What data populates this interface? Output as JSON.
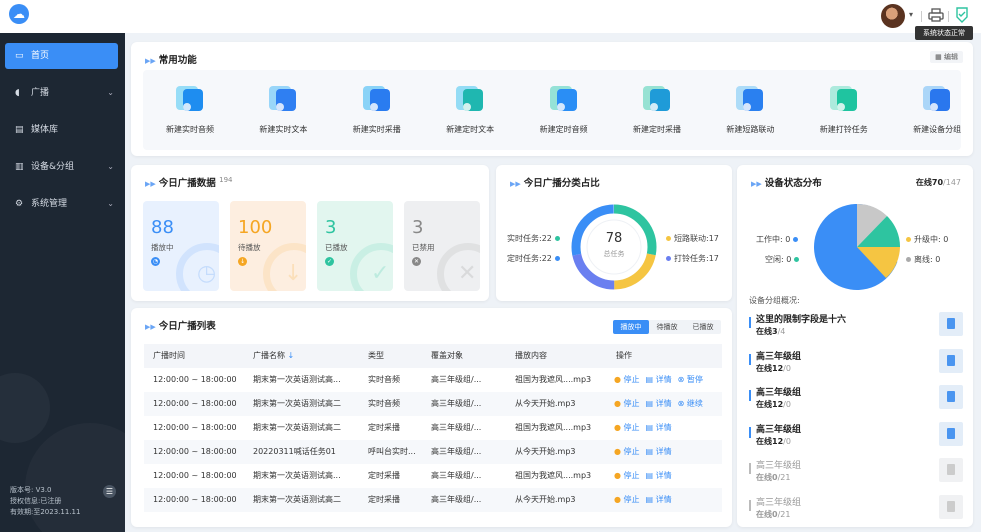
{
  "topbar": {
    "tooltip": "系统状态正常"
  },
  "sidebar": {
    "items": [
      {
        "label": "首页",
        "icon": "monitor-icon"
      },
      {
        "label": "广播",
        "icon": "broadcast-icon"
      },
      {
        "label": "媒体库",
        "icon": "media-library-icon"
      },
      {
        "label": "设备&分组",
        "icon": "device-icon"
      },
      {
        "label": "系统管理",
        "icon": "settings-icon"
      }
    ],
    "version": "版本号: V3.0",
    "license": "授权信息:已注册",
    "expiry": "有效期:至2023.11.11"
  },
  "quick": {
    "title": "常用功能",
    "edit": "编辑",
    "items": [
      {
        "label": "新建实时音频",
        "icon": "music-note-icon"
      },
      {
        "label": "新建实时文本",
        "icon": "text-icon"
      },
      {
        "label": "新建实时采播",
        "icon": "capture-icon"
      },
      {
        "label": "新建定时文本",
        "icon": "timed-text-icon"
      },
      {
        "label": "新建定时音频",
        "icon": "timed-audio-icon"
      },
      {
        "label": "新建定时采播",
        "icon": "timed-capture-icon"
      },
      {
        "label": "新建短路联动",
        "icon": "link-icon"
      },
      {
        "label": "新建打铃任务",
        "icon": "bell-icon"
      },
      {
        "label": "新建设备分组",
        "icon": "device-group-icon"
      }
    ]
  },
  "today_data": {
    "title": "今日广播数据",
    "count": "194",
    "stats": [
      {
        "value": "88",
        "label": "播放中",
        "color": "#3a8ef6",
        "bg": "#e8f1fe"
      },
      {
        "value": "100",
        "label": "待播放",
        "color": "#f5a623",
        "bg": "#fdeee0"
      },
      {
        "value": "3",
        "label": "已播放",
        "color": "#2ec4a0",
        "bg": "#e2f6ef"
      },
      {
        "value": "3",
        "label": "已禁用",
        "color": "#888888",
        "bg": "#eeeff1"
      }
    ]
  },
  "category": {
    "title": "今日广播分类占比",
    "total": "78",
    "total_label": "总任务",
    "legend_left": [
      {
        "label": "实时任务:22",
        "color": "#2ec4a0"
      },
      {
        "label": "定时任务:22",
        "color": "#3a8ef6"
      }
    ],
    "legend_right": [
      {
        "label": "短路联动:17",
        "color": "#f5c542"
      },
      {
        "label": "打铃任务:17",
        "color": "#6a7ff0"
      }
    ]
  },
  "device_status": {
    "title": "设备状态分布",
    "online_label": "在线",
    "online": "70",
    "total": "/147",
    "legend": [
      {
        "label": "工作中: 0",
        "color": "#3a8ef6"
      },
      {
        "label": "空闲: 0",
        "color": "#2ec4a0"
      },
      {
        "label": "升级中: 0",
        "color": "#f5c542"
      },
      {
        "label": "离线: 0",
        "color": "#aaaaaa"
      }
    ],
    "groups_title": "设备分组概况:",
    "groups": [
      {
        "name": "这里的限制字段是十六",
        "online": "在线3",
        "total": "/4"
      },
      {
        "name": "高三年级组",
        "online": "在线12",
        "total": "/0"
      },
      {
        "name": "高三年级组",
        "online": "在线12",
        "total": "/0"
      },
      {
        "name": "高三年级组",
        "online": "在线12",
        "total": "/0"
      },
      {
        "name": "高三年级组",
        "online": "在线0",
        "total": "/21"
      },
      {
        "name": "高三年级组",
        "online": "在线0",
        "total": "/21"
      }
    ]
  },
  "list": {
    "title": "今日广播列表",
    "tabs": [
      "播放中",
      "待播放",
      "已播放"
    ],
    "headers": [
      "广播时间",
      "广播名称",
      "类型",
      "覆盖对象",
      "播放内容",
      "操作"
    ],
    "rows": [
      {
        "time": "12:00:00 ~ 18:00:00",
        "name": "期末第一次英语测试高...",
        "type": "实时音频",
        "target": "高三年级组/...",
        "content": "祖国为我遮风....mp3",
        "extra": "暂停"
      },
      {
        "time": "12:00:00 ~ 18:00:00",
        "name": "期末第一次英语测试高二",
        "type": "实时音频",
        "target": "高三年级组/...",
        "content": "从今天开始.mp3",
        "extra": "继续"
      },
      {
        "time": "12:00:00 ~ 18:00:00",
        "name": "期末第一次英语测试高二",
        "type": "定时采播",
        "target": "高三年级组/...",
        "content": "祖国为我遮风....mp3",
        "extra": ""
      },
      {
        "time": "12:00:00 ~ 18:00:00",
        "name": "20220311喊话任务01",
        "type": "呼叫台实时...",
        "target": "高三年级组/...",
        "content": "从今天开始.mp3",
        "extra": ""
      },
      {
        "time": "12:00:00 ~ 18:00:00",
        "name": "期末第一次英语测试高...",
        "type": "定时采播",
        "target": "高三年级组/...",
        "content": "祖国为我遮风....mp3",
        "extra": ""
      },
      {
        "time": "12:00:00 ~ 18:00:00",
        "name": "期末第一次英语测试高二",
        "type": "定时采播",
        "target": "高三年级组/...",
        "content": "从今天开始.mp3",
        "extra": ""
      }
    ],
    "stop": "停止",
    "detail": "详情"
  }
}
